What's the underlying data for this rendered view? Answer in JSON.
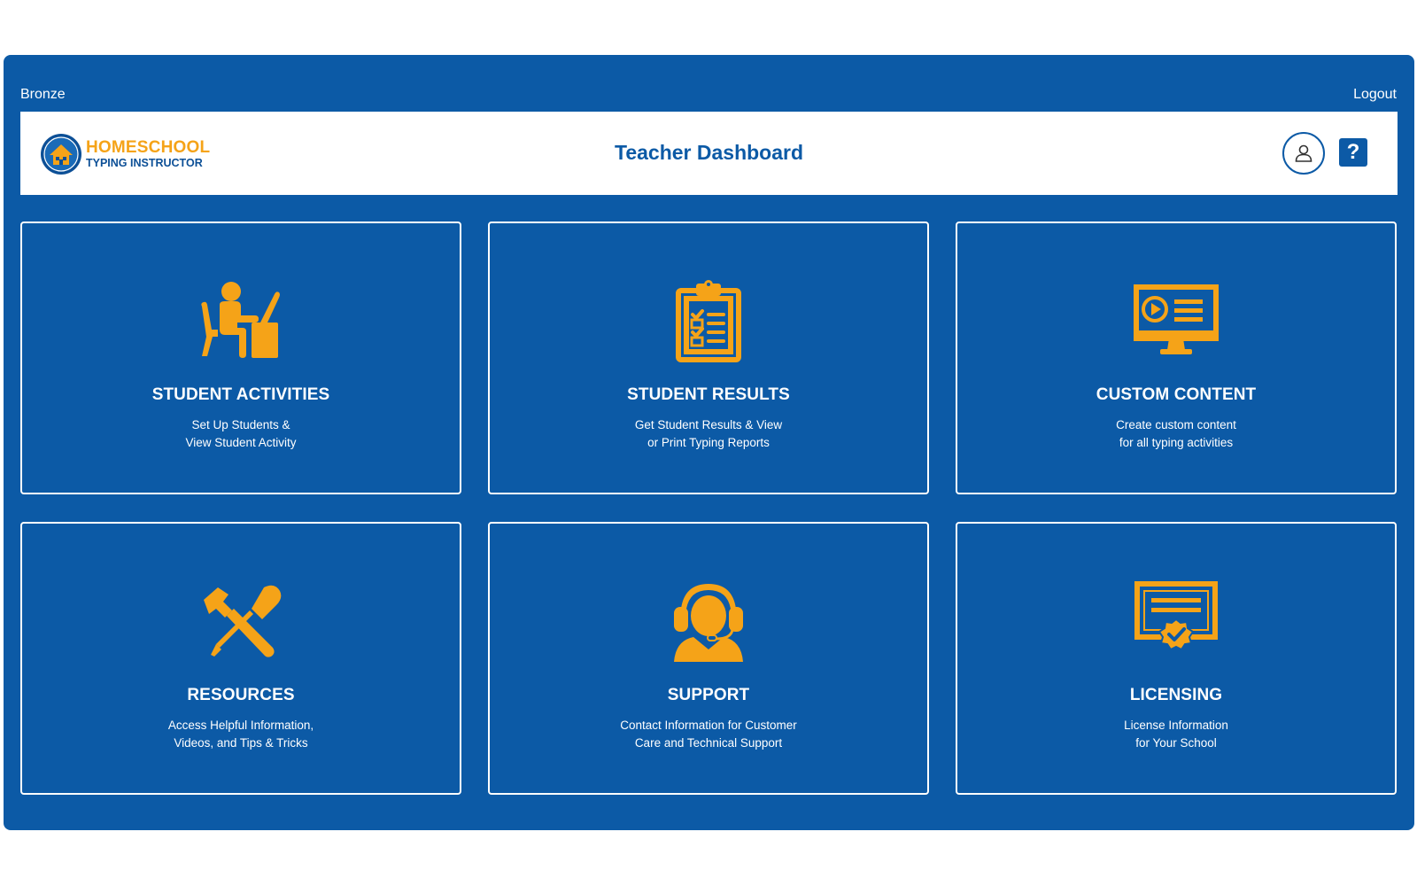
{
  "colors": {
    "brand_blue": "#0c5aa6",
    "accent_orange": "#f5a318",
    "white": "#ffffff"
  },
  "topbar": {
    "plan_label": "Bronze",
    "logout_label": "Logout"
  },
  "header": {
    "logo": {
      "line1": "HOMESCHOOL",
      "line2": "TYPING INSTRUCTOR",
      "icon": "house-badge-icon"
    },
    "title": "Teacher Dashboard",
    "user_icon": "user-profile-icon",
    "help_label": "?"
  },
  "tiles": [
    {
      "icon": "student-at-desk-icon",
      "title": "STUDENT ACTIVITIES",
      "description": "Set Up Students &\nView Student Activity"
    },
    {
      "icon": "clipboard-checklist-icon",
      "title": "STUDENT RESULTS",
      "description": "Get Student Results & View\nor Print Typing Reports"
    },
    {
      "icon": "monitor-video-icon",
      "title": "CUSTOM CONTENT",
      "description": "Create custom content\nfor all typing activities"
    },
    {
      "icon": "hammer-screwdriver-icon",
      "title": "RESOURCES",
      "description": "Access Helpful Information,\nVideos, and Tips & Tricks"
    },
    {
      "icon": "headset-support-icon",
      "title": "SUPPORT",
      "description": "Contact Information for Customer\nCare and Technical Support"
    },
    {
      "icon": "certificate-icon",
      "title": "LICENSING",
      "description": "License Information\nfor Your School"
    }
  ]
}
